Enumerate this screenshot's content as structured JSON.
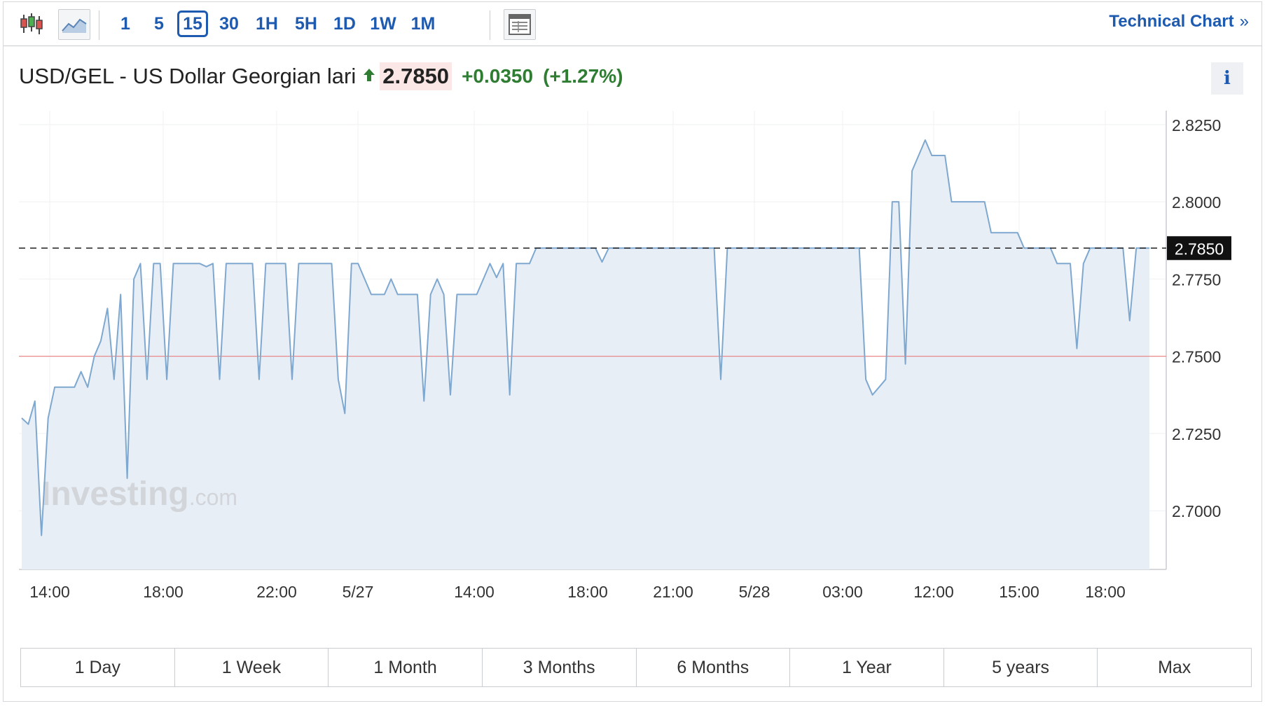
{
  "toolbar": {
    "intervals": [
      "1",
      "5",
      "15",
      "30",
      "1H",
      "5H",
      "1D",
      "1W",
      "1M"
    ],
    "active_interval": "15",
    "technical_chart_label": "Technical Chart",
    "technical_chart_chevron": "»"
  },
  "header": {
    "title": "USD/GEL - US Dollar Georgian lari",
    "price": "2.7850",
    "change": "+0.0350",
    "change_pct": "(+1.27%)",
    "info_label": "i"
  },
  "colors": {
    "accent": "#1e5bb0",
    "up": "#2f7d32",
    "line": "#7ea8cf",
    "area": "#e8eef6",
    "prev_close": "#e88a8a"
  },
  "chart_data": {
    "type": "area",
    "symbol": "USD/GEL",
    "x_tick_labels": [
      "14:00",
      "18:00",
      "22:00",
      "5/27",
      "14:00",
      "18:00",
      "21:00",
      "5/28",
      "03:00",
      "12:00",
      "15:00",
      "18:00"
    ],
    "y_tick_labels": [
      "2.8250",
      "2.8000",
      "2.7750",
      "2.7500",
      "2.7250",
      "2.7000"
    ],
    "ylim": [
      2.681,
      2.8295
    ],
    "current_price": 2.785,
    "current_price_label": "2.7850",
    "reference_line": 2.75,
    "grid": true,
    "watermark": "Investing.com",
    "watermark_main": "Investing",
    "watermark_suffix": ".com",
    "values": [
      2.73,
      2.728,
      2.7355,
      2.692,
      2.73,
      2.74,
      2.74,
      2.74,
      2.74,
      2.745,
      2.74,
      2.75,
      2.755,
      2.7655,
      2.7425,
      2.77,
      2.7105,
      2.775,
      2.78,
      2.7425,
      2.78,
      2.78,
      2.7425,
      2.78,
      2.78,
      2.78,
      2.78,
      2.78,
      2.779,
      2.78,
      2.7425,
      2.78,
      2.78,
      2.78,
      2.78,
      2.78,
      2.7425,
      2.78,
      2.78,
      2.78,
      2.78,
      2.7425,
      2.78,
      2.78,
      2.78,
      2.78,
      2.78,
      2.78,
      2.7425,
      2.7315,
      2.78,
      2.78,
      2.775,
      2.77,
      2.77,
      2.77,
      2.775,
      2.77,
      2.77,
      2.77,
      2.77,
      2.7355,
      2.77,
      2.775,
      2.77,
      2.7375,
      2.77,
      2.77,
      2.77,
      2.77,
      2.775,
      2.78,
      2.7755,
      2.78,
      2.7375,
      2.78,
      2.78,
      2.78,
      2.785,
      2.785,
      2.785,
      2.785,
      2.785,
      2.785,
      2.785,
      2.785,
      2.785,
      2.785,
      2.7805,
      2.785,
      2.785,
      2.785,
      2.785,
      2.785,
      2.785,
      2.785,
      2.785,
      2.785,
      2.785,
      2.785,
      2.785,
      2.785,
      2.785,
      2.785,
      2.785,
      2.785,
      2.7425,
      2.785,
      2.785,
      2.785,
      2.785,
      2.785,
      2.785,
      2.785,
      2.785,
      2.785,
      2.785,
      2.785,
      2.785,
      2.785,
      2.785,
      2.785,
      2.785,
      2.785,
      2.785,
      2.785,
      2.785,
      2.785,
      2.7425,
      2.7375,
      2.74,
      2.7425,
      2.8,
      2.8,
      2.7475,
      2.81,
      2.815,
      2.82,
      2.815,
      2.815,
      2.815,
      2.8,
      2.8,
      2.8,
      2.8,
      2.8,
      2.8,
      2.79,
      2.79,
      2.79,
      2.79,
      2.79,
      2.785,
      2.785,
      2.785,
      2.785,
      2.785,
      2.78,
      2.78,
      2.78,
      2.7525,
      2.78,
      2.785,
      2.785,
      2.785,
      2.785,
      2.785,
      2.785,
      2.7615,
      2.785,
      2.785,
      2.785
    ]
  },
  "ranges": [
    "1 Day",
    "1 Week",
    "1 Month",
    "3 Months",
    "6 Months",
    "1 Year",
    "5 years",
    "Max"
  ]
}
